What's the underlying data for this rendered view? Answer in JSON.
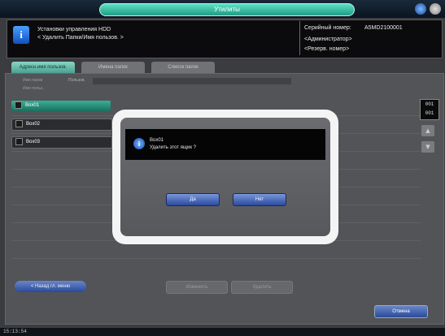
{
  "topbar": {
    "title": "Утилиты"
  },
  "header": {
    "title_line1": "Установки управления HDD",
    "title_line2": "< Удалить Папки/Имя пользов. >",
    "serial_label": "Серийный номер:",
    "serial_value": "A5MD2100001",
    "admin_label": "<Администратор>",
    "remain_label": "<Резерв. номер>"
  },
  "tabs": [
    {
      "label": "Адресн.имя пользов."
    },
    {
      "label": "Имена папок"
    },
    {
      "label": "Список папок"
    }
  ],
  "fields": {
    "name_label": "Имя папки",
    "name_value": "Пользов.",
    "pass_label": "Имя польз."
  },
  "list": [
    {
      "label": "Box01"
    },
    {
      "label": "Box02"
    },
    {
      "label": "Box03"
    }
  ],
  "pager": {
    "current": "001",
    "total": "001",
    "up": "▲",
    "down": "▼"
  },
  "buttons": {
    "back": "< Назад гл. меню",
    "edit": "Изменить",
    "delete": "Удалить",
    "ok": "Отмена"
  },
  "status": {
    "time": "15:13:54"
  },
  "modal": {
    "line1": "Box01",
    "line2": "Удалить этот ящик ?",
    "yes": "Да",
    "no": "Нет"
  },
  "colors": {
    "accent": "#2a4aa0",
    "title_pill": "#3cc0a6",
    "selected_row": "#2a9080"
  }
}
